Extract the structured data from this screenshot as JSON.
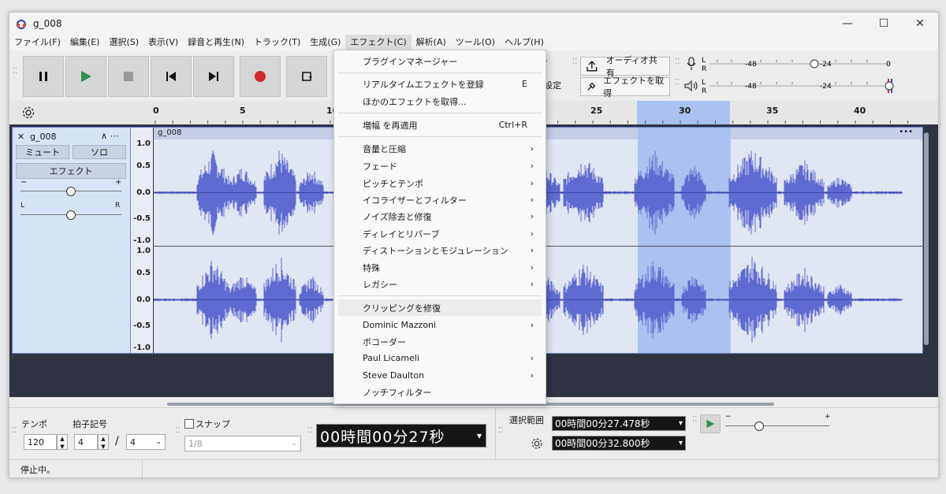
{
  "window": {
    "title": "g_008"
  },
  "menubar": [
    "ファイル(F)",
    "編集(E)",
    "選択(S)",
    "表示(V)",
    "録音と再生(N)",
    "トラック(T)",
    "生成(G)",
    "エフェクト(C)",
    "解析(A)",
    "ツール(O)",
    "ヘルプ(H)"
  ],
  "toolbar": {
    "audio_share": "オーディオ共有",
    "get_effects": "エフェクトを取得",
    "settings_partial": "設定",
    "meter_labels": [
      "-48",
      "-24",
      "0"
    ],
    "meter_l": "L",
    "meter_r": "R"
  },
  "ruler": {
    "ticks": [
      "0",
      "5",
      "10",
      "25",
      "30",
      "35",
      "40"
    ]
  },
  "track": {
    "name": "g_008",
    "clip_name": "g_008",
    "mute": "ミュート",
    "solo": "ソロ",
    "effects": "エフェクト",
    "gain_min": "−",
    "gain_max": "+",
    "pan_l": "L",
    "pan_r": "R",
    "scale_labels": [
      "1.0",
      "0.5",
      "0.0",
      "-0.5",
      "-1.0"
    ],
    "more": "•••",
    "collapse": "∧ ⋯",
    "close": "✕"
  },
  "effect_menu": {
    "items": [
      {
        "label": "プラグインマネージャー",
        "shortcut": "",
        "sub": false
      },
      {
        "label": "リアルタイムエフェクトを登録",
        "shortcut": "E",
        "sub": false
      },
      {
        "label": "ほかのエフェクトを取得...",
        "shortcut": "",
        "sub": false
      },
      {
        "label": "増幅 を再適用",
        "shortcut": "Ctrl+R",
        "sub": false
      },
      {
        "label": "音量と圧縮",
        "shortcut": "",
        "sub": true
      },
      {
        "label": "フェード",
        "shortcut": "",
        "sub": true
      },
      {
        "label": "ピッチとテンポ",
        "shortcut": "",
        "sub": true
      },
      {
        "label": "イコライザーとフィルター",
        "shortcut": "",
        "sub": true
      },
      {
        "label": "ノイズ除去と修復",
        "shortcut": "",
        "sub": true
      },
      {
        "label": "ディレイとリバーブ",
        "shortcut": "",
        "sub": true
      },
      {
        "label": "ディストーションとモジュレーション",
        "shortcut": "",
        "sub": true
      },
      {
        "label": "特殊",
        "shortcut": "",
        "sub": true
      },
      {
        "label": "レガシー",
        "shortcut": "",
        "sub": true
      },
      {
        "label": "クリッピングを修復",
        "shortcut": "",
        "sub": false
      },
      {
        "label": "Dominic Mazzoni",
        "shortcut": "",
        "sub": true
      },
      {
        "label": "ボコーダー",
        "shortcut": "",
        "sub": false
      },
      {
        "label": "Paul Licameli",
        "shortcut": "",
        "sub": true
      },
      {
        "label": "Steve Daulton",
        "shortcut": "",
        "sub": true
      },
      {
        "label": "ノッチフィルター",
        "shortcut": "",
        "sub": false
      }
    ],
    "arrow": "›"
  },
  "bottom": {
    "tempo_label": "テンポ",
    "tempo_value": "120",
    "timesig_label": "拍子記号",
    "timesig_num": "4",
    "timesig_den": "4",
    "slash": "/",
    "snap_label": "スナップ",
    "snap_value": "1/8",
    "time": "00時間00分27秒",
    "selection_label": "選択範囲",
    "sel_start": "00時間00分27.478秒",
    "sel_end": "00時間00分32.800秒",
    "vol_min": "−",
    "vol_max": "+"
  },
  "status": {
    "text": "停止中。"
  },
  "colors": {
    "wave": "#5e6bd0",
    "selection": "#aac2f0",
    "record": "#d22a2a",
    "play": "#2f8f4f"
  }
}
